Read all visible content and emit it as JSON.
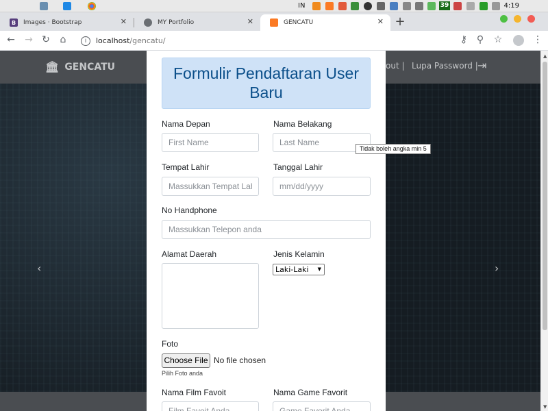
{
  "menubar": {
    "input_indicator": "IN",
    "badge_count": "39",
    "clock": "4:19"
  },
  "tabs": [
    {
      "title": "Images · Bootstrap",
      "favicon": "B",
      "color": "#563d7c"
    },
    {
      "title": "MY Portfolio",
      "favicon": "globe",
      "color": "#5f6368"
    },
    {
      "title": "GENCATU",
      "favicon": "xampp",
      "color": "#fb7a24"
    }
  ],
  "address": {
    "host": "localhost",
    "path": "/gencatu/"
  },
  "site": {
    "brand": "GENCATU",
    "nav_logout": "out |",
    "nav_forgot": "Lupa Password |"
  },
  "form": {
    "title": "Formulir Pendaftaran User Baru",
    "first_name_label": "Nama Depan",
    "first_name_placeholder": "First Name",
    "last_name_label": "Nama Belakang",
    "last_name_placeholder": "Last Name",
    "birthplace_label": "Tempat Lahir",
    "birthplace_placeholder": "Massukkan Tempat Lahir",
    "birthdate_label": "Tanggal Lahir",
    "birthdate_placeholder": "mm/dd/yyyy",
    "phone_label": "No Handphone",
    "phone_placeholder": "Massukkan Telepon anda",
    "address_label": "Alamat Daerah",
    "gender_label": "Jenis Kelamin",
    "gender_selected": "Laki-Laki",
    "photo_label": "Foto",
    "choose_file": "Choose File",
    "no_file": "No file chosen",
    "photo_help": "Pilih Foto anda",
    "film_label": "Nama Film Favoit",
    "film_placeholder": "Film Favoit Anda",
    "game_label": "Nama Game Favorit",
    "game_placeholder": "Game Favorit Anda"
  },
  "tooltip": "Tidak boleh angka min 5"
}
